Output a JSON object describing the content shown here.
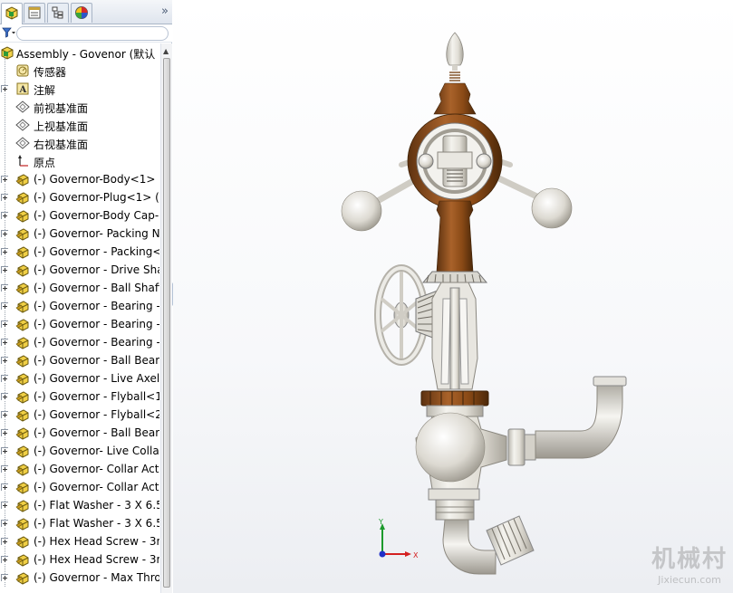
{
  "panel": {
    "tabs": [
      {
        "name": "featuremanager-tab-icon"
      },
      {
        "name": "propertymanager-tab-icon"
      },
      {
        "name": "configurationmanager-tab-icon"
      },
      {
        "name": "appearance-tab-icon"
      }
    ],
    "collapse_glyph": "»"
  },
  "tree": {
    "root": "Assembly - Govenor  (默认",
    "items": [
      {
        "label": "传感器",
        "icon": "sensor-icon",
        "expandable": false
      },
      {
        "label": "注解",
        "icon": "annotation-icon",
        "expandable": true
      },
      {
        "label": "前视基准面",
        "icon": "plane-icon",
        "expandable": false
      },
      {
        "label": "上视基准面",
        "icon": "plane-icon",
        "expandable": false
      },
      {
        "label": "右视基准面",
        "icon": "plane-icon",
        "expandable": false
      },
      {
        "label": "原点",
        "icon": "origin-icon",
        "expandable": false
      },
      {
        "label": "(-) Governor-Body<1>",
        "icon": "part-icon",
        "expandable": true
      },
      {
        "label": "(-) Governor-Plug<1> (",
        "icon": "part-icon",
        "expandable": true
      },
      {
        "label": "(-) Governor-Body Cap-",
        "icon": "part-icon",
        "expandable": true
      },
      {
        "label": "(-) Governor- Packing N",
        "icon": "part-icon",
        "expandable": true
      },
      {
        "label": "(-) Governor - Packing<",
        "icon": "part-icon",
        "expandable": true
      },
      {
        "label": "(-) Governor - Drive Sha",
        "icon": "part-icon",
        "expandable": true
      },
      {
        "label": "(-) Governor - Ball Shaft",
        "icon": "part-icon",
        "expandable": true
      },
      {
        "label": "(-) Governor - Bearing -",
        "icon": "part-icon",
        "expandable": true
      },
      {
        "label": "(-) Governor - Bearing -",
        "icon": "part-icon",
        "expandable": true
      },
      {
        "label": "(-) Governor - Bearing -",
        "icon": "part-icon",
        "expandable": true
      },
      {
        "label": "(-) Governor - Ball Bear",
        "icon": "part-icon",
        "expandable": true
      },
      {
        "label": "(-) Governor - Live Axel",
        "icon": "part-icon",
        "expandable": true
      },
      {
        "label": "(-) Governor - Flyball<1",
        "icon": "part-icon",
        "expandable": true
      },
      {
        "label": "(-) Governor - Flyball<2",
        "icon": "part-icon",
        "expandable": true
      },
      {
        "label": "(-) Governor - Ball Bear",
        "icon": "part-icon",
        "expandable": true
      },
      {
        "label": "(-) Governor- Live Colla",
        "icon": "part-icon",
        "expandable": true
      },
      {
        "label": "(-) Governor- Collar Act",
        "icon": "part-icon",
        "expandable": true
      },
      {
        "label": "(-) Governor- Collar Act",
        "icon": "part-icon",
        "expandable": true
      },
      {
        "label": "(-) Flat Washer - 3 X 6.5",
        "icon": "part-icon",
        "expandable": true
      },
      {
        "label": "(-) Flat Washer - 3 X 6.5",
        "icon": "part-icon",
        "expandable": true
      },
      {
        "label": "(-) Hex Head Screw - 3r",
        "icon": "part-icon",
        "expandable": true
      },
      {
        "label": "(-) Hex Head Screw - 3r",
        "icon": "part-icon",
        "expandable": true
      },
      {
        "label": "(-) Governor - Max Thro",
        "icon": "part-icon",
        "expandable": true
      }
    ]
  },
  "triad": {
    "y_label": "Y",
    "x_label": "X"
  },
  "watermark": {
    "cn": "机械村",
    "en": "Jixiecun.com"
  },
  "colors": {
    "bronze": "#8a4a16",
    "metal": "#e3e1da",
    "axis_x": "#d42020",
    "axis_y": "#1c9a2c",
    "axis_z": "#2030c8"
  }
}
